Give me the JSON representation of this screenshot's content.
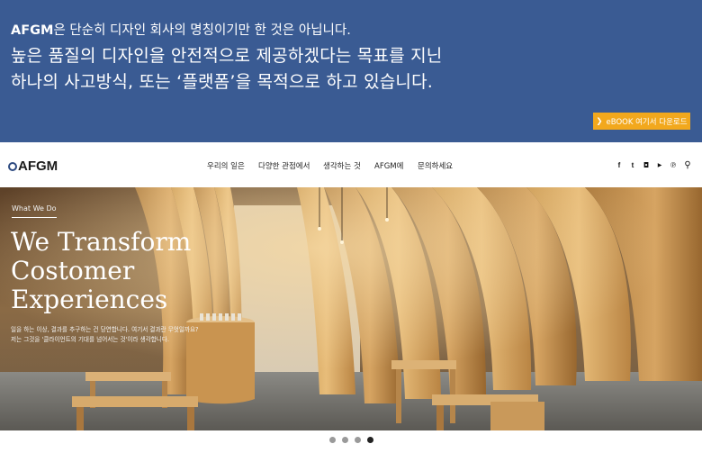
{
  "banner": {
    "line1_brand": "AFGM",
    "line1_rest": "은 단순히 디자인 회사의 명칭이기만 한 것은 아닙니다.",
    "line2": "높은 품질의 디자인을 안전적으로 제공하겠다는 목표를 지닌",
    "line3": "하나의 사고방식, 또는 ‘플랫폼’을 목적으로 하고 있습니다.",
    "ebook_arrow": "❯",
    "ebook_label": "eBOOK 여기서 다운로드",
    "background_color": "#3a5b93",
    "button_color": "#f2a81d"
  },
  "nav": {
    "logo_text": "AFGM",
    "items": [
      {
        "label": "우리의 일은"
      },
      {
        "label": "다양한 관점에서"
      },
      {
        "label": "생각하는 것"
      },
      {
        "label": "AFGM에"
      },
      {
        "label": "문의하세요"
      }
    ],
    "social_icons": [
      {
        "icon": "facebook-icon",
        "glyph": "f"
      },
      {
        "icon": "twitter-icon",
        "glyph": "t"
      },
      {
        "icon": "instagram-icon",
        "glyph": "◘"
      },
      {
        "icon": "youtube-icon",
        "glyph": "▶"
      },
      {
        "icon": "pinterest-icon",
        "glyph": "℗"
      },
      {
        "icon": "search-icon",
        "glyph": "⚲"
      }
    ]
  },
  "hero": {
    "tag": "What We Do",
    "title_lines": [
      "We Transform",
      "Costomer",
      "Experiences"
    ],
    "desc_lines": [
      "일을 하는 이상, 결과를 추구하는 건 당연합니다. 여기서 결과란 무엇일까요?",
      "저는 그것을 '클라이언트의 기대를 넘어서는 것'이라 생각합니다."
    ]
  },
  "slider": {
    "dot_count": 4,
    "active_index": 3
  }
}
